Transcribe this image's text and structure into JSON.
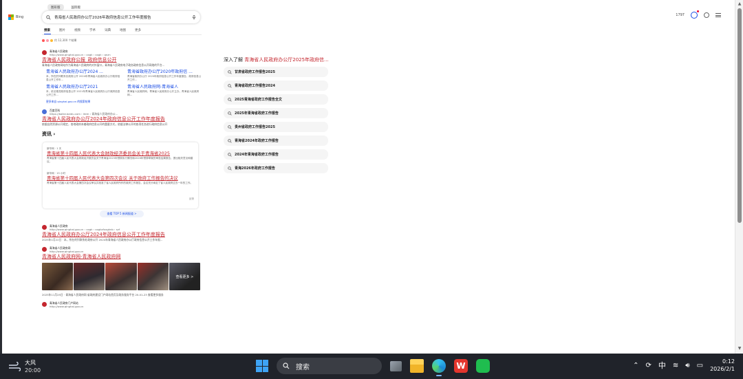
{
  "browser": {
    "brand": "Bing",
    "chips": [
      "图形版",
      "国际版"
    ],
    "query": "青海省人民政府办公厅2026年政府信息公开工作年度报告",
    "tabs": [
      "搜索",
      "图片",
      "视频",
      "学术",
      "词典",
      "地图",
      "更多"
    ],
    "points": "1797",
    "meta": "约 12,300 个结果"
  },
  "results": [
    {
      "site": "青海省人民政府",
      "url": "http://www.qinghai.gov.cn › xxgk › xxgk › qnzn",
      "title": "青海省人民政府公报_政府信息公开",
      "snippet": "青海省人民政府网站作为青海省人民政府的对外窗口，青海省人民政府电子政务政府信息公开网络的平台..."
    },
    {
      "site": "百度百科",
      "url": "https://baike.baidu.com › item › 青海省人民政府办公...",
      "title": "青海省人民政府办公厅2024年政府信息公开工作年度报告",
      "snippet": "依据自然资源公开规定，各地政府本着政府信息公开的重要方式，依据法律公开的各项任务进行政府信息公开"
    },
    {
      "site": "青海省人民政府",
      "url": "http://www.qinghai.gov.cn › xxgk › xxgkzfxxgknb › szf",
      "title": "青海省人民政府办公厅2024年政府信息公开工作年度报告",
      "snippet": "2025年1月22日 · 本，所在的列联系处政府公开 2024年青海省人民政府办公厅政府信息公开工作年报..."
    },
    {
      "site": "青海省人民政府网",
      "url": "http://www.qinghai.gov.cn",
      "title": "青海省人民政府网-青海省人民政府网"
    },
    {
      "site": "青海省人民政府门户网站",
      "url": "http://www.qinghai.gov.cn"
    }
  ],
  "deeplinks": [
    {
      "title": "青海省人民政府办公厅2024 ...",
      "snippet": "本，所在的列联系处政府公开 2024年青海省人民政府办公厅政府信息公开工作年..."
    },
    {
      "title": "青海省政府办公厅2020年政府信 ...",
      "snippet": "青海省政府办公厅 2020年政府信息公开工作年度报告，政府信息公开工作..."
    },
    {
      "title": "青海省人民政府办公厅2021",
      "snippet": "本，依法推进政府信息公开 2021年青海省人民政府办公厅政府信息公开工作..."
    },
    {
      "title": "青海省人民政府网-青海省人",
      "snippet": "青海省人民政府网，青海省人民政府办公厅主办，青海省人民政府网..."
    }
  ],
  "more_site": "更多来自 qinghai.gov.cn 的搜索结果",
  "news": {
    "heading": "资讯",
    "items": [
      {
        "source": "新华网 · 1 天",
        "title": "青海省第十四届人民代表大会财政经济委员会关于青海省2025",
        "snippet": "青海省第十四届人民代表大会财政经济委员会关于青海省2025年预算执行情况和2026年预算草案的审查结果报告，提出相关意见和建议。"
      },
      {
        "source": "新华网 · 15 小时",
        "title": "青海省第十四届人民代表大会第四次会议 关于政府工作报告的决议",
        "snippet": "青海省第十四届人民代表大会第四次会议审议并批准了省人民政府所作的政府工作报告，会议充分肯定了省人民政府过去一年的工作。"
      }
    ],
    "feedback": "反馈",
    "more_label": "查看 TOP 5 新闻报道 >"
  },
  "image_strip_more": "查看更多 >",
  "last_snippet": "2025年11月25日 · 青海省人民政府网 省政府建设门户网站首页及政务服务平台 20-01-23 查看更多服务",
  "related": {
    "prefix": "深入了解",
    "query": "青海省人民政府办公厅2025年政府信...",
    "items": [
      "甘肃省政府工作报告2025",
      "青海省政府工作报告2024",
      "2025青海省政府工作报告全文",
      "2025年青海省政府工作报告",
      "贵州省政府工作报告2025",
      "青海省2024年政府工作报告",
      "2024年青海省政府工作报告",
      "青海2026年政府工作报告"
    ]
  },
  "taskbar": {
    "weather_label": "大风",
    "weather_temp": "20:00",
    "search_label": "搜索",
    "ime": "中",
    "time": "0:12",
    "date": "2026/2/1"
  },
  "colors": {
    "link": "#c4262e",
    "accent": "#174ae4",
    "taskbar": "#20232a"
  }
}
